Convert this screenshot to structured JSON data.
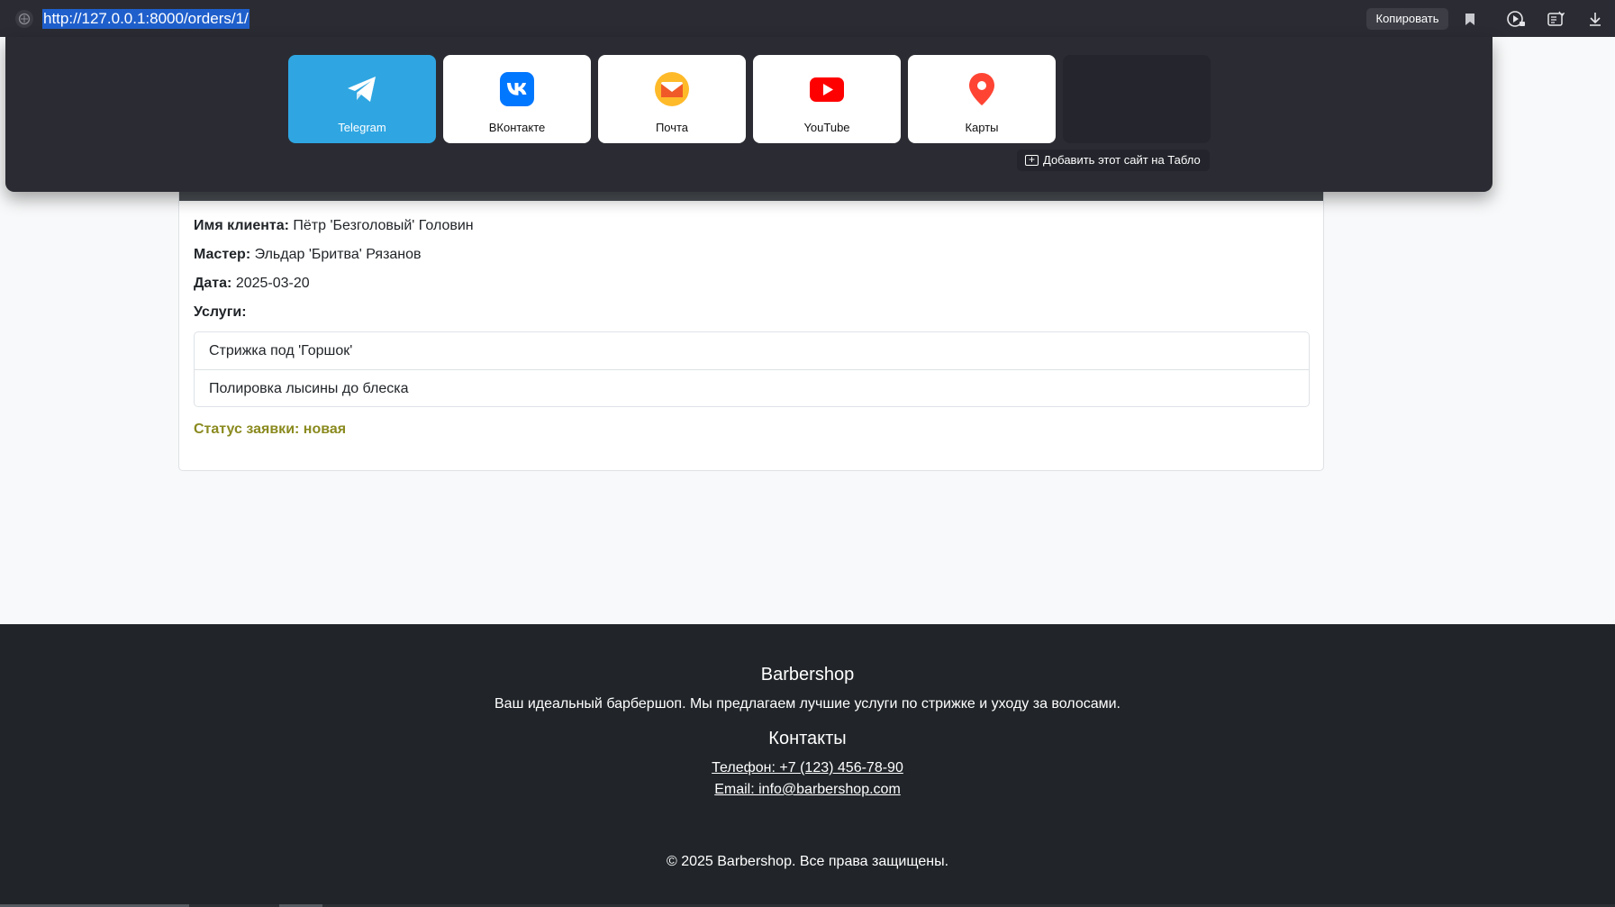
{
  "browser": {
    "url": "http://127.0.0.1:8000/orders/1/",
    "copy_label": "Копировать",
    "icons": [
      "site-settings-icon",
      "bookmark-icon",
      "media-player-icon",
      "reader-mode-icon",
      "download-icon"
    ]
  },
  "tablo": {
    "tiles": [
      {
        "label": "Telegram",
        "icon": "telegram-icon",
        "color": "#2fa6e2"
      },
      {
        "label": "ВКонтакте",
        "icon": "vk-icon",
        "color": "#0077ff"
      },
      {
        "label": "Почта",
        "icon": "mail-icon",
        "color": "#ffba2a"
      },
      {
        "label": "YouTube",
        "icon": "youtube-icon",
        "color": "#ff0000"
      },
      {
        "label": "Карты",
        "icon": "map-pin-icon",
        "color": "#ff4433"
      }
    ],
    "add_site_label": "Добавить этот сайт на Табло"
  },
  "order": {
    "client_label": "Имя клиента:",
    "client_value": "Пётр 'Безголовый' Головин",
    "master_label": "Мастер:",
    "master_value": "Эльдар 'Бритва' Рязанов",
    "date_label": "Дата:",
    "date_value": "2025-03-20",
    "services_label": "Услуги:",
    "services": [
      "Стрижка под 'Горшок'",
      "Полировка лысины до блеска"
    ],
    "status_text": "Статус заявки: новая",
    "status_color": "#8a8a1f"
  },
  "footer": {
    "brand": "Barbershop",
    "description": "Ваш идеальный барбершоп. Мы предлагаем лучшие услуги по стрижке и уходу за волосами.",
    "contacts_title": "Контакты",
    "phone": "Телефон: +7 (123) 456-78-90",
    "email": "Email: info@barbershop.com",
    "copyright": "© 2025 Barbershop. Все права защищены."
  }
}
